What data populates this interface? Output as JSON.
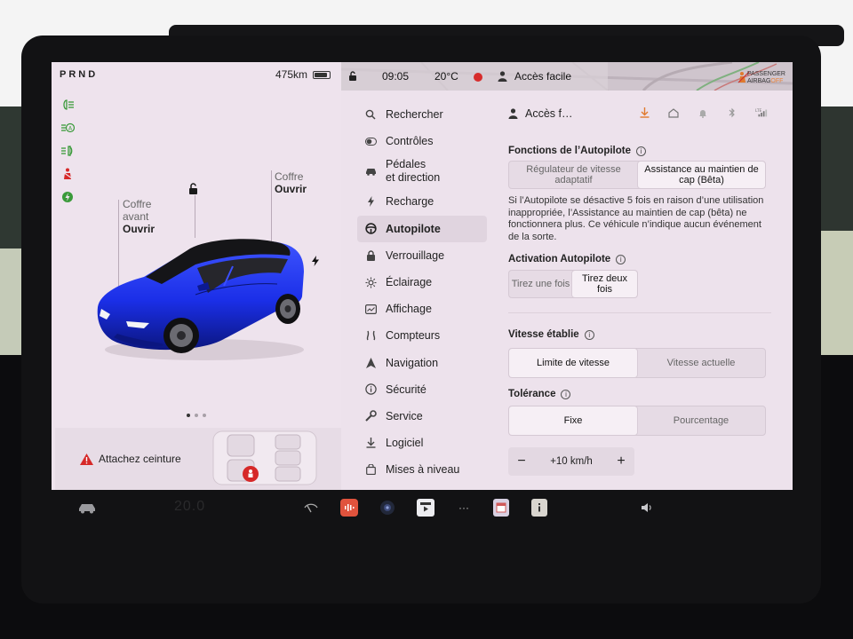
{
  "car": {
    "gear": "PRND",
    "range": "475km",
    "battery_level": 0.9,
    "trunk_front": {
      "line1": "Coffre",
      "line2": "avant",
      "action": "Ouvrir"
    },
    "trunk_rear": {
      "line1": "Coffre",
      "action": "Ouvrir"
    },
    "body_color": "#1b2fe8",
    "carousel_pages": 3,
    "carousel_active": 0
  },
  "alert": {
    "text": "Attachez ceinture"
  },
  "status": {
    "time": "09:05",
    "temperature": "20°C",
    "profile": "Accès facile",
    "airbag_line1": "PASSENGER",
    "airbag_line2_a": "AIRBAG",
    "airbag_line2_b": "OFF"
  },
  "menu": {
    "items": [
      {
        "label": "Rechercher",
        "icon": "search-icon"
      },
      {
        "label": "Contrôles",
        "icon": "toggle-icon"
      },
      {
        "label1": "Pédales",
        "label2": "et direction",
        "icon": "car-icon"
      },
      {
        "label": "Recharge",
        "icon": "bolt-icon"
      },
      {
        "label": "Autopilote",
        "icon": "steering-wheel-icon",
        "active": true
      },
      {
        "label": "Verrouillage",
        "icon": "lock-icon"
      },
      {
        "label": "Éclairage",
        "icon": "sun-icon"
      },
      {
        "label": "Affichage",
        "icon": "display-icon"
      },
      {
        "label": "Compteurs",
        "icon": "road-icon"
      },
      {
        "label": "Navigation",
        "icon": "navigation-arrow-icon"
      },
      {
        "label": "Sécurité",
        "icon": "shield-info-icon"
      },
      {
        "label": "Service",
        "icon": "wrench-icon"
      },
      {
        "label": "Logiciel",
        "icon": "download-icon"
      },
      {
        "label": "Mises à niveau",
        "icon": "bag-icon"
      }
    ]
  },
  "content": {
    "profile_short": "Accès f…",
    "lte": "LTE",
    "autopilot_features": {
      "title": "Fonctions de l’Autopilote",
      "options": [
        "Régulateur de vitesse adaptatif",
        "Assistance au maintien de cap (Bêta)"
      ],
      "selected": 1,
      "note": "Si l’Autopilote se désactive 5 fois en raison d’une utilisation inappropriée, l’Assistance au maintien de cap (bêta) ne fonctionnera plus. Ce véhicule n’indique aucun événement de la sorte."
    },
    "activation": {
      "title": "Activation Autopilote",
      "options": [
        "Tirez une fois",
        "Tirez deux fois"
      ],
      "selected": 1
    },
    "speed_set": {
      "title": "Vitesse établie",
      "options": [
        "Limite de vitesse",
        "Vitesse actuelle"
      ],
      "selected": 0
    },
    "tolerance": {
      "title": "Tolérance",
      "options": [
        "Fixe",
        "Pourcentage"
      ],
      "selected": 0
    },
    "offset": {
      "minus": "−",
      "value": "+10 km/h",
      "plus": "+"
    }
  },
  "dock": {
    "temperature": "20.0",
    "ellipsis": "···"
  },
  "colors": {
    "screen_bg": "#ede2ec",
    "accent_red": "#d72c2c",
    "accent_orange": "#e07a2e",
    "tell_green": "#3a9a3a"
  }
}
